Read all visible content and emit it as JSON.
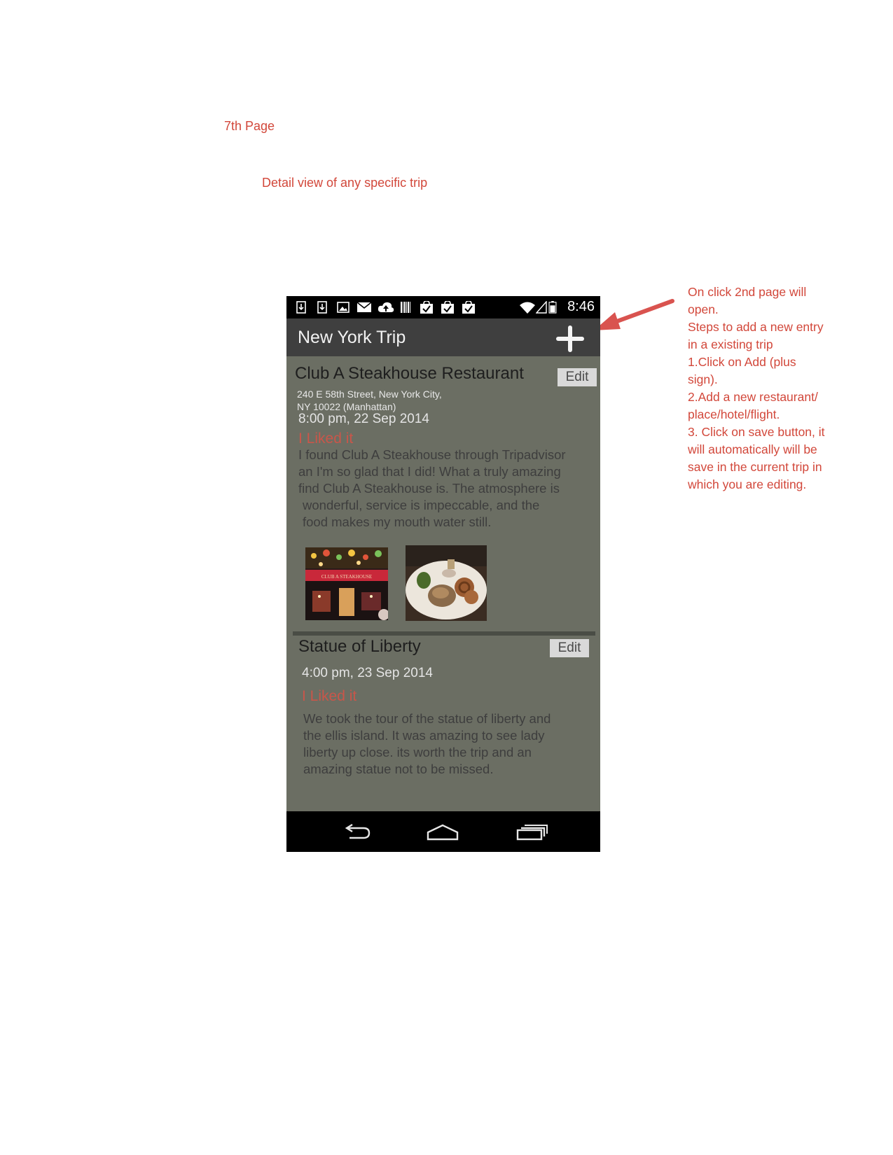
{
  "doc": {
    "page_label": "7th Page",
    "subtitle": "Detail view of any specific trip",
    "annotation_lines": [
      "On click 2nd page will",
      "open.",
      "Steps to add a new entry",
      "in a existing trip",
      "1.Click on Add (plus",
      "sign).",
      "2.Add a new restaurant/",
      "place/hotel/flight.",
      "3. Click on save button, it",
      "will automatically will be",
      "save in the current trip in",
      "which you are editing."
    ],
    "accent_color": "#d2473a"
  },
  "status_bar": {
    "time": "8:46",
    "icons": [
      "download-icon",
      "download-icon",
      "image-icon",
      "mail-icon",
      "cloud-upload-icon",
      "barcode-icon",
      "bag-check-icon",
      "bag-check-icon",
      "bag-check-icon",
      "wifi-icon",
      "signal-icon",
      "battery-icon"
    ]
  },
  "app_bar": {
    "title": "New York Trip",
    "add_icon": "plus-icon"
  },
  "entries": [
    {
      "title": "Club A Steakhouse Restaurant",
      "edit_label": "Edit",
      "address_line1": "240 E 58th Street, New York City,",
      "address_line2": "NY 10022 (Manhattan)",
      "datetime": "8:00 pm, 22 Sep 2014",
      "liked": "I Liked it",
      "description_lines": [
        "I found Club A Steakhouse through Tripadvisor",
        "an I'm so glad that I did! What a truly amazing",
        "find Club A Steakhouse is. The atmosphere is",
        "wonderful, service is impeccable, and the",
        "food makes my mouth water still."
      ],
      "photo1_sign": "CLUB A STEAKHOUSE"
    },
    {
      "title": "Statue of Liberty",
      "edit_label": "Edit",
      "datetime": "4:00 pm, 23 Sep 2014",
      "liked": "I Liked it",
      "description_lines": [
        "We took the tour of the statue of liberty and",
        "the ellis island. It was amazing to see lady",
        "liberty up close. its worth the trip and an",
        "amazing statue not to be missed."
      ]
    }
  ],
  "nav_bar": {
    "icons": [
      "back-icon",
      "home-icon",
      "recent-apps-icon"
    ]
  }
}
